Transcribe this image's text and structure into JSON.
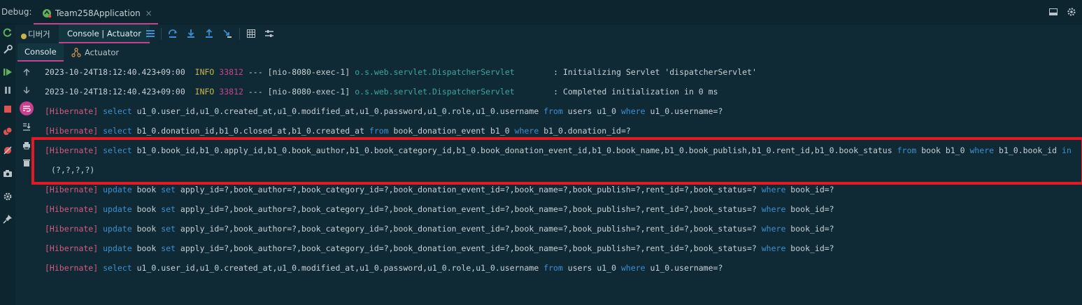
{
  "titlebar": {
    "debug_label": "Debug:",
    "run_tab": "Team258Application",
    "close": "×"
  },
  "toolbar": {
    "tab_debugger": "디버거",
    "tab_console_actuator": "Console | Actuator"
  },
  "subtabs": {
    "console": "Console",
    "actuator": "Actuator"
  },
  "log": {
    "l1": {
      "ts": "2023-10-24T18:12:40.423+09:00",
      "level": "INFO",
      "pid": "33812",
      "sep": "---",
      "thread": "[nio-8080-exec-1]",
      "logger": "o.s.web.servlet.DispatcherServlet",
      "msg": ": Initializing Servlet 'dispatcherServlet'"
    },
    "l2": {
      "ts": "2023-10-24T18:12:40.423+09:00",
      "level": "INFO",
      "pid": "33812",
      "sep": "---",
      "thread": "[nio-8080-exec-1]",
      "logger": "o.s.web.servlet.DispatcherServlet",
      "msg": ": Completed initialization in 0 ms"
    },
    "hib": "[Hibernate]",
    "l3": {
      "a": "select",
      "b": " u1_0.user_id,u1_0.created_at,u1_0.modified_at,u1_0.password,u1_0.role,u1_0.username ",
      "c": "from",
      "d": " users u1_0 ",
      "e": "where",
      "f": " u1_0.username=?"
    },
    "l4": {
      "a": "select",
      "b": " b1_0.donation_id,b1_0.closed_at,b1_0.created_at ",
      "c": "from",
      "d": " book_donation_event b1_0 ",
      "e": "where",
      "f": " b1_0.donation_id=?"
    },
    "l5": {
      "a": "select",
      "b": " b1_0.book_id,b1_0.apply_id,b1_0.book_author,b1_0.book_category_id,b1_0.book_donation_event_id,b1_0.book_name,b1_0.book_publish,b1_0.rent_id,b1_0.book_status ",
      "c": "from",
      "d": " book b1_0 ",
      "e": "where",
      "f": " b1_0.book_id ",
      "g": "in"
    },
    "l5b": "(?,?,?,?)",
    "upd": {
      "a": "update",
      "b": " book ",
      "c": "set",
      "d": " apply_id=?,book_author=?,book_category_id=?,book_donation_event_id=?,book_name=?,book_publish=?,rent_id=?,book_status=? ",
      "e": "where",
      "f": " book_id=?"
    },
    "l10": {
      "a": "select",
      "b": " u1_0.user_id,u1_0.created_at,u1_0.modified_at,u1_0.password,u1_0.role,u1_0.username ",
      "c": "from",
      "d": " users u1_0 ",
      "e": "where",
      "f": " u1_0.username=?"
    }
  },
  "colors": {
    "background": "#0f2a34",
    "hibernate": "#d65a82",
    "keyword": "#3d8fd1",
    "info": "#c8b44a",
    "highlight_box": "#e01b24",
    "tab_underline": "#c8418e"
  }
}
